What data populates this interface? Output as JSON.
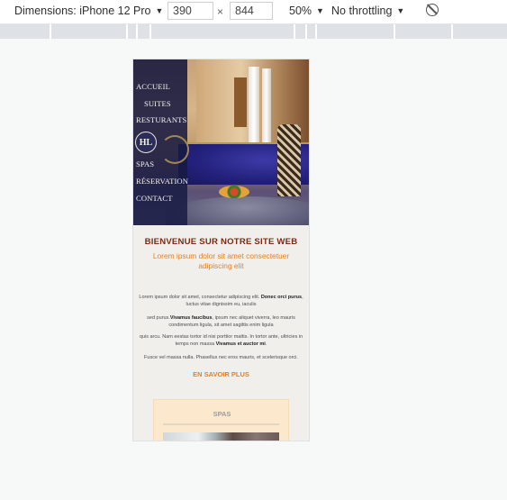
{
  "devtools": {
    "dimensions_label": "Dimensions: iPhone 12 Pro",
    "width_value": "390",
    "height_value": "844",
    "times_symbol": "×",
    "zoom_label": "50%",
    "throttling_label": "No throttling",
    "caret": "▼",
    "rotate_icon": "rotate-icon"
  },
  "site": {
    "menu": {
      "items": [
        "ACCUEIL",
        "SUITES",
        "RESTURANTS",
        "SPAS",
        "RÉSERVATION",
        "CONTACT"
      ],
      "logo_text": "HL"
    },
    "title": "BIENVENUE SUR NOTRE SITE WEB",
    "subtitle": "Lorem ipsum dolor sit amet consectetuer adipiscing elit",
    "paragraphs": [
      {
        "before": "Lorem ipsum dolor sit amet, consectetur adipiscing elit. ",
        "bold": "Donec orci purus",
        "after": ", luctus vitae dignissim eu, iaculis"
      },
      {
        "before": "sed purus.",
        "bold": "Vivamus faucibus",
        "after": ", ipsum nec aliquet viverra, leo mauris condimentum ligula, sit amet sagittis enim ligula"
      },
      {
        "before": "quis arcu. Nam eestas tortor id nisi porttior mattis. In tortor ante, ultricies in temps non massa ",
        "bold": "Vivamus et auctor mi",
        "after": "."
      },
      {
        "before": "Fusce vel massa nulla. Phasellus nec eros mauris, et scelerisque orci.",
        "bold": "",
        "after": ""
      }
    ],
    "more_link": "EN SAVOIR PLUS",
    "spas_title": "SPAS"
  }
}
